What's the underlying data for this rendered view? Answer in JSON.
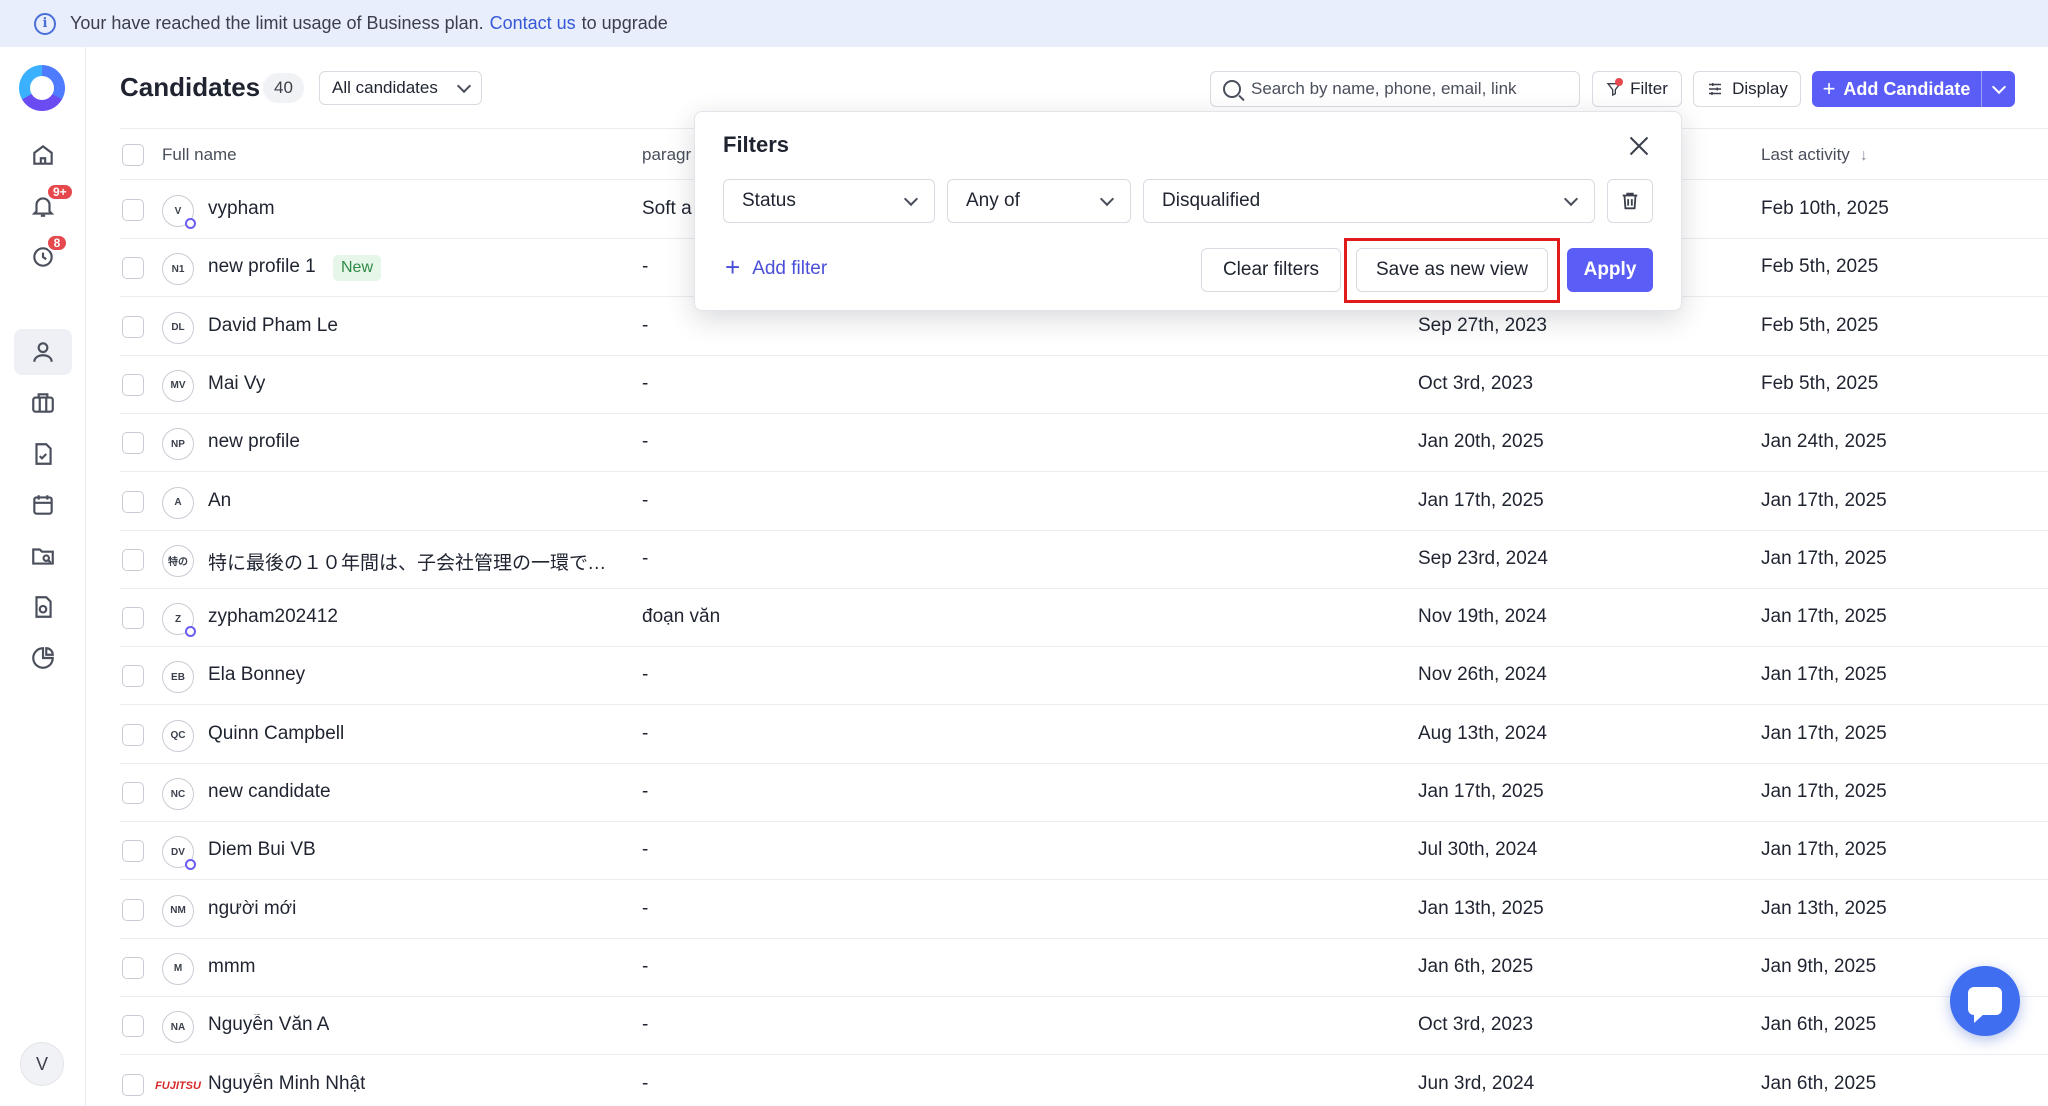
{
  "banner": {
    "text_before": "Your have reached the limit usage of Business plan.",
    "link": "Contact us",
    "text_after": "to upgrade"
  },
  "sidebar": {
    "items": [
      {
        "name": "home",
        "icon": "home-icon"
      },
      {
        "name": "notifications",
        "icon": "bell-icon",
        "badge": "9+"
      },
      {
        "name": "activity",
        "icon": "clock-icon",
        "badge": "8"
      },
      {
        "name": "candidates",
        "icon": "user-icon",
        "active": true
      },
      {
        "name": "jobs",
        "icon": "briefcase-icon"
      },
      {
        "name": "tasks",
        "icon": "file-check-icon"
      },
      {
        "name": "calendar",
        "icon": "calendar-icon"
      },
      {
        "name": "search-folder",
        "icon": "folder-search-icon"
      },
      {
        "name": "settings",
        "icon": "file-gear-icon"
      },
      {
        "name": "reports",
        "icon": "pie-chart-icon"
      }
    ],
    "user_initial": "V"
  },
  "header": {
    "title": "Candidates",
    "count": "40",
    "view_select": "All candidates",
    "search_placeholder": "Search by name, phone, email, link",
    "filter_label": "Filter",
    "display_label": "Display",
    "add_label": "Add Candidate"
  },
  "table": {
    "columns": {
      "full_name": "Full name",
      "paragraph": "paragr",
      "last_activity": "Last activity"
    },
    "rows": [
      {
        "initials": "V",
        "name": "vypham",
        "online": true,
        "para": "Soft a",
        "created": "",
        "last": "Feb 10th, 2025"
      },
      {
        "initials": "N1",
        "name": "new profile 1",
        "tag": "New",
        "para": "-",
        "created": "",
        "last": "Feb 5th, 2025"
      },
      {
        "initials": "DL",
        "name": "David Pham Le",
        "para": "-",
        "created": "Sep 27th, 2023",
        "last": "Feb 5th, 2025"
      },
      {
        "initials": "MV",
        "name": "Mai Vy",
        "para": "-",
        "created": "Oct 3rd, 2023",
        "last": "Feb 5th, 2025"
      },
      {
        "initials": "NP",
        "name": "new profile",
        "para": "-",
        "created": "Jan 20th, 2025",
        "last": "Jan 24th, 2025"
      },
      {
        "initials": "A",
        "name": "An",
        "para": "-",
        "created": "Jan 17th, 2025",
        "last": "Jan 17th, 2025"
      },
      {
        "initials": "特の",
        "name": "特に最後の１０年間は、子会社管理の一環で、...",
        "para": "-",
        "created": "Sep 23rd, 2024",
        "last": "Jan 17th, 2025"
      },
      {
        "initials": "Z",
        "name": "zypham202412",
        "online": true,
        "para": "đoạn văn",
        "created": "Nov 19th, 2024",
        "last": "Jan 17th, 2025"
      },
      {
        "initials": "EB",
        "name": "Ela Bonney",
        "para": "-",
        "created": "Nov 26th, 2024",
        "last": "Jan 17th, 2025"
      },
      {
        "initials": "QC",
        "name": "Quinn Campbell",
        "para": "-",
        "created": "Aug 13th, 2024",
        "last": "Jan 17th, 2025"
      },
      {
        "initials": "NC",
        "name": "new candidate",
        "para": "-",
        "created": "Jan 17th, 2025",
        "last": "Jan 17th, 2025"
      },
      {
        "initials": "DV",
        "name": "Diem Bui VB",
        "online": true,
        "para": "-",
        "created": "Jul 30th, 2024",
        "last": "Jan 17th, 2025"
      },
      {
        "initials": "NM",
        "name": "người mới",
        "para": "-",
        "created": "Jan 13th, 2025",
        "last": "Jan 13th, 2025"
      },
      {
        "initials": "M",
        "name": "mmm",
        "para": "-",
        "created": "Jan 6th, 2025",
        "last": "Jan 9th, 2025"
      },
      {
        "initials": "NA",
        "name": "Nguyễn Văn A",
        "para": "-",
        "created": "Oct 3rd, 2023",
        "last": "Jan 6th, 2025"
      },
      {
        "initials": "FUJITSU",
        "logo": true,
        "name": "Nguyễn Minh Nhật",
        "para": "-",
        "created": "Jun 3rd, 2024",
        "last": "Jan 6th, 2025"
      }
    ]
  },
  "filters": {
    "title": "Filters",
    "field": "Status",
    "operator": "Any of",
    "value": "Disqualified",
    "add_filter": "Add filter",
    "clear": "Clear filters",
    "save_view": "Save as new view",
    "apply": "Apply"
  },
  "colors": {
    "accent": "#5b5ef6",
    "highlight": "#e01b1b",
    "badge": "#e5484d"
  }
}
